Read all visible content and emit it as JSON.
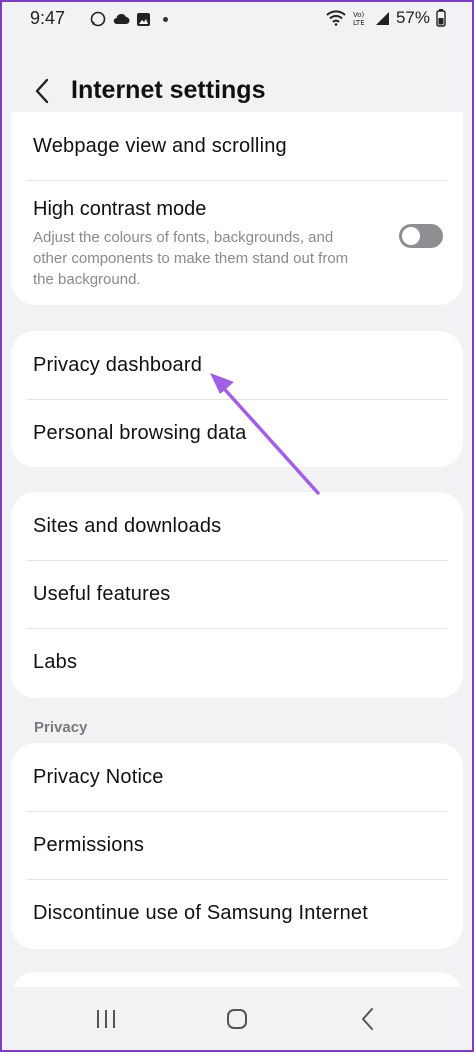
{
  "status_bar": {
    "time": "9:47",
    "battery": "57%",
    "left_icons": [
      "whatsapp-icon",
      "cloud-icon",
      "image-icon",
      "dot-icon"
    ],
    "right_icons": [
      "wifi-icon",
      "volte-icon",
      "signal-icon"
    ]
  },
  "header": {
    "title": "Internet settings"
  },
  "card1": {
    "webpage_view": "Webpage view and scrolling",
    "high_contrast_title": "High contrast mode",
    "high_contrast_desc": "Adjust the colours of fonts, backgrounds, and other components to make them stand out from the background.",
    "high_contrast_enabled": false
  },
  "card2": {
    "items": [
      "Privacy dashboard",
      "Personal browsing data"
    ]
  },
  "card3": {
    "items": [
      "Sites and downloads",
      "Useful features",
      "Labs"
    ]
  },
  "privacy_section": {
    "label": "Privacy",
    "items": [
      "Privacy Notice",
      "Permissions",
      "Discontinue use of Samsung Internet"
    ]
  },
  "colors": {
    "frame": "#7d3fc1",
    "arrow": "#a35ee6",
    "toggle_off": "#8f8f93"
  },
  "nav_bar": {
    "icons": [
      "recent-apps-icon",
      "home-icon",
      "back-icon"
    ]
  }
}
